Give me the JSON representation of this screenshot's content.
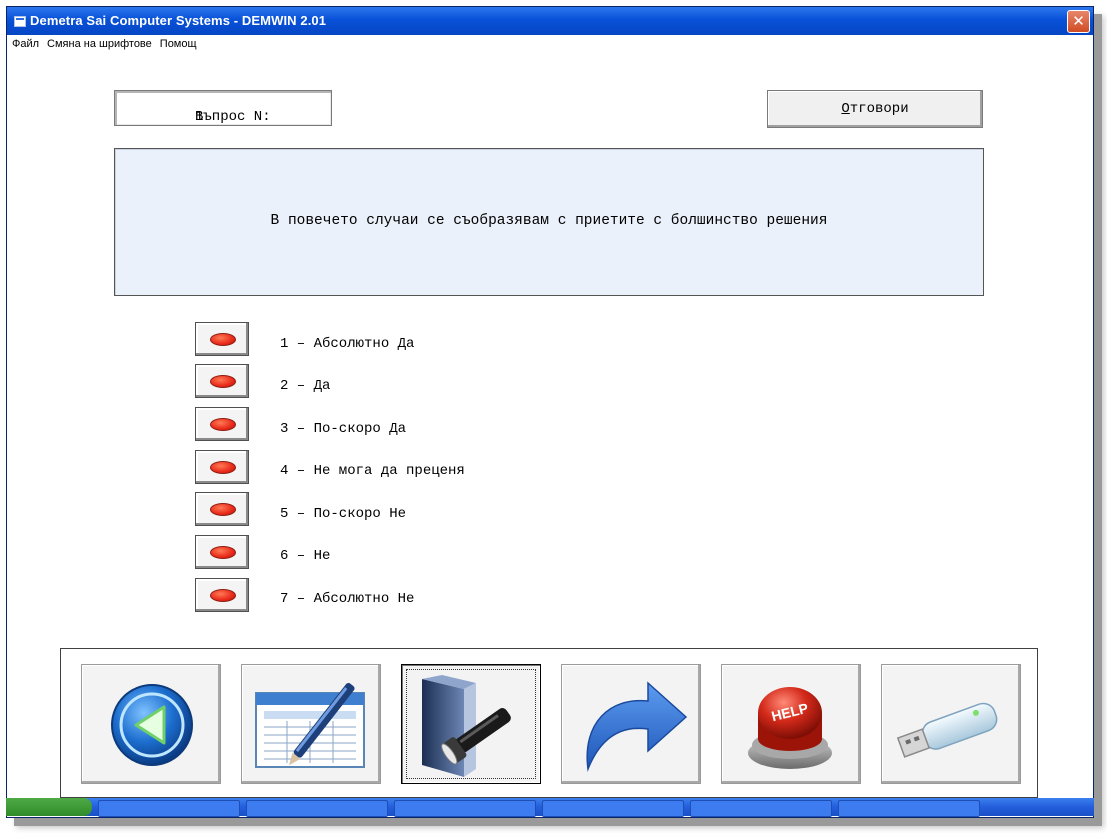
{
  "window": {
    "title": "Demetra Sai Computer Systems - DEMWIN 2.01",
    "close_glyph": "✕"
  },
  "menu": {
    "items": [
      "Файл",
      "Смяна на шрифтове",
      "Помощ"
    ]
  },
  "question": {
    "number_label": "Въпрос N:",
    "number": "1",
    "text": "В повечето случаи се съобразявам с приетите с болшинство решения"
  },
  "answers_button": {
    "label": "Отговори",
    "mnemonic": "О"
  },
  "options": [
    {
      "label": "1 – Абсолютно Да"
    },
    {
      "label": "2 – Да"
    },
    {
      "label": "3 – По-скоро Да"
    },
    {
      "label": "4 – Не мога да преценя"
    },
    {
      "label": "5 – По-скоро Не"
    },
    {
      "label": "6 – Не"
    },
    {
      "label": "7 – Абсолютно Не"
    }
  ],
  "toolbar": {
    "buttons": [
      {
        "icon": "back-arrow-icon"
      },
      {
        "icon": "spreadsheet-pen-icon"
      },
      {
        "icon": "folder-flashlight-icon",
        "active": true
      },
      {
        "icon": "forward-arrow-icon"
      },
      {
        "icon": "help-button-icon",
        "text": "HELP"
      },
      {
        "icon": "usb-drive-icon"
      }
    ]
  },
  "colors": {
    "titlebar": "#0851d8",
    "question_bg": "#eaf1fa",
    "option_led": "#e8291a",
    "help_red": "#d42a1a",
    "arrow_blue": "#2f6fd6"
  }
}
